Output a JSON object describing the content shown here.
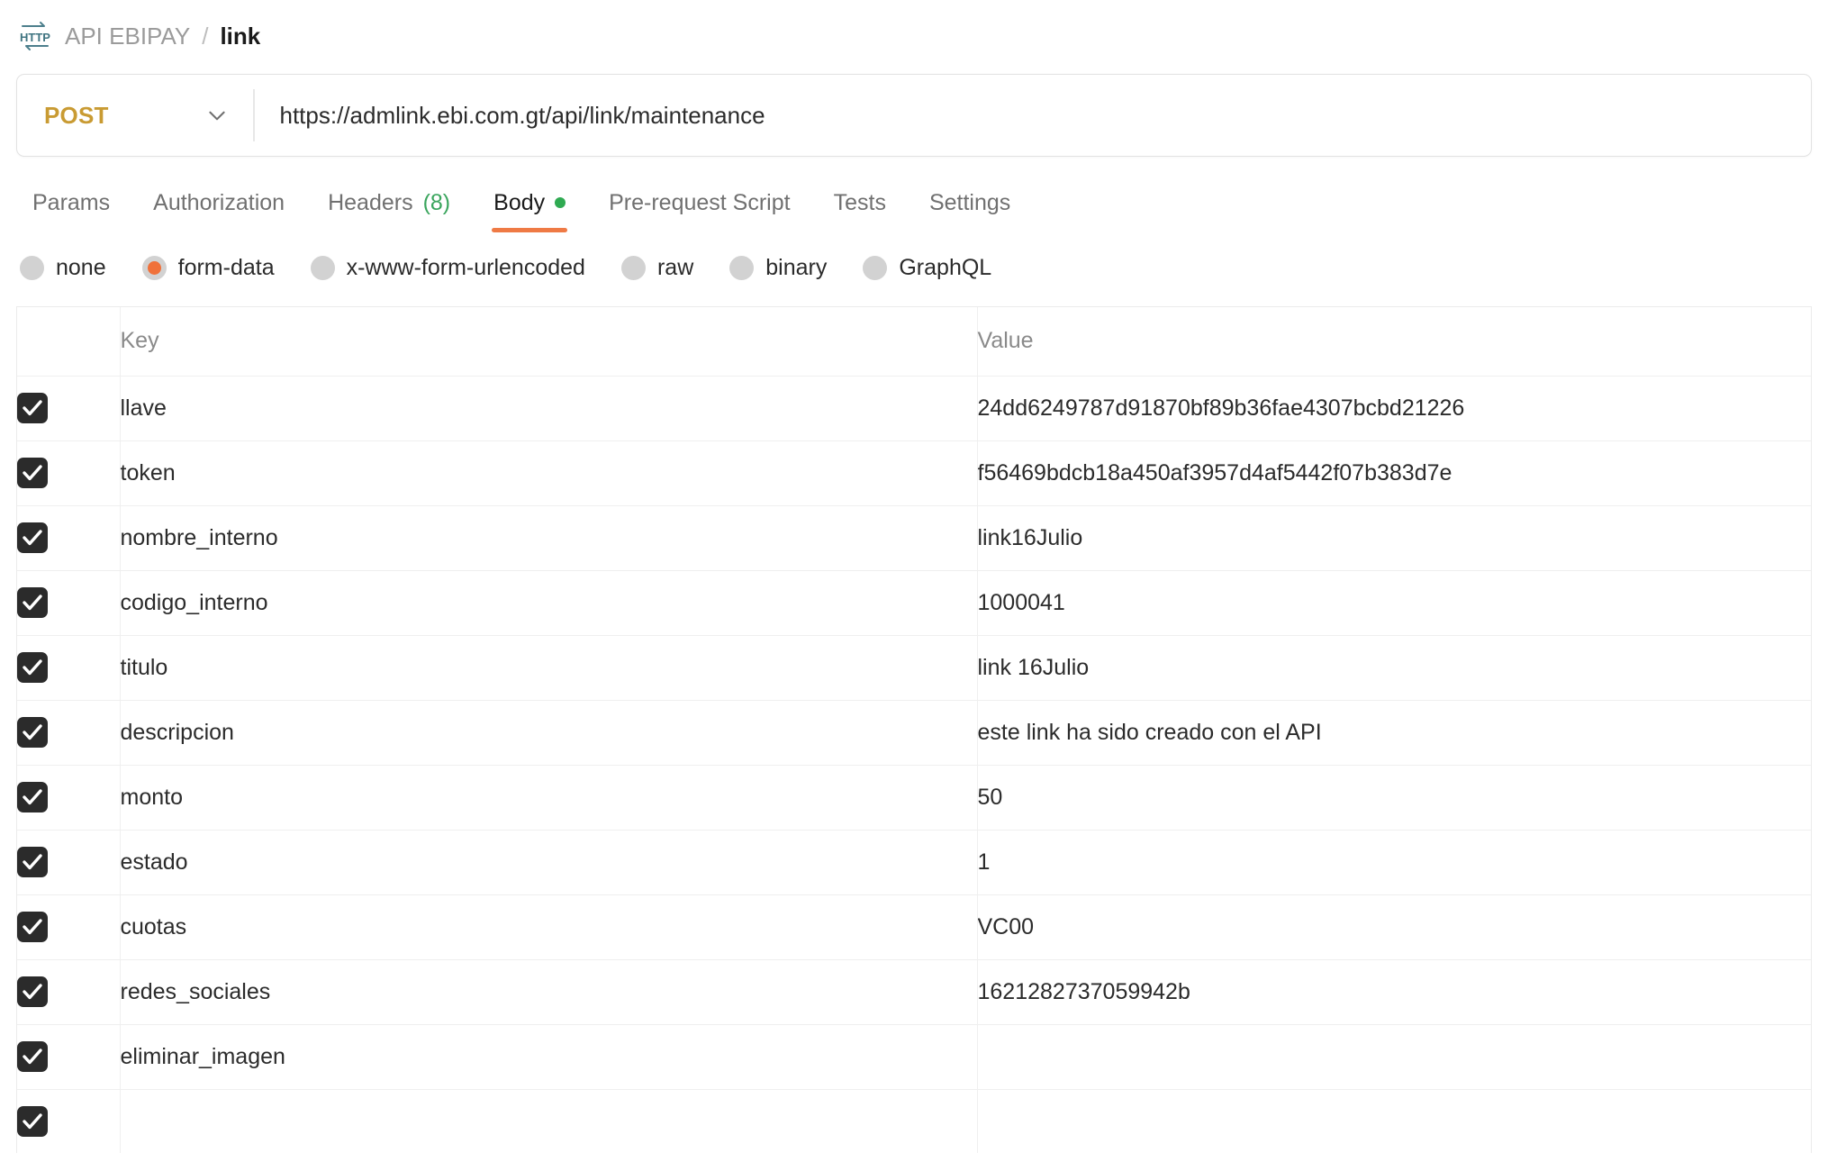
{
  "breadcrumb": {
    "icon": "http-icon",
    "collection": "API EBIPAY",
    "separator": "/",
    "current": "link"
  },
  "request_bar": {
    "method": "POST",
    "method_chevron_icon": "chevron-down-icon",
    "url": "https://admlink.ebi.com.gt/api/link/maintenance"
  },
  "tabs": [
    {
      "label": "Params",
      "active": false
    },
    {
      "label": "Authorization",
      "active": false
    },
    {
      "label": "Headers",
      "count": "(8)",
      "active": false
    },
    {
      "label": "Body",
      "active": true,
      "dot": true
    },
    {
      "label": "Pre-request Script",
      "active": false
    },
    {
      "label": "Tests",
      "active": false
    },
    {
      "label": "Settings",
      "active": false
    }
  ],
  "body_types": [
    {
      "label": "none",
      "selected": false
    },
    {
      "label": "form-data",
      "selected": true
    },
    {
      "label": "x-www-form-urlencoded",
      "selected": false
    },
    {
      "label": "raw",
      "selected": false
    },
    {
      "label": "binary",
      "selected": false
    },
    {
      "label": "GraphQL",
      "selected": false
    }
  ],
  "table": {
    "columns": {
      "key": "Key",
      "value": "Value"
    },
    "rows": [
      {
        "checked": true,
        "key": "llave",
        "value": "24dd6249787d91870bf89b36fae4307bcbd21226"
      },
      {
        "checked": true,
        "key": "token",
        "value": "f56469bdcb18a450af3957d4af5442f07b383d7e"
      },
      {
        "checked": true,
        "key": "nombre_interno",
        "value": "link16Julio"
      },
      {
        "checked": true,
        "key": "codigo_interno",
        "value": "1000041"
      },
      {
        "checked": true,
        "key": "titulo",
        "value": "link 16Julio"
      },
      {
        "checked": true,
        "key": "descripcion",
        "value": "este link ha sido creado con el API"
      },
      {
        "checked": true,
        "key": "monto",
        "value": "50"
      },
      {
        "checked": true,
        "key": "estado",
        "value": "1"
      },
      {
        "checked": true,
        "key": "cuotas",
        "value": "VC00"
      },
      {
        "checked": true,
        "key": "redes_sociales",
        "value": "1621282737059942b"
      },
      {
        "checked": true,
        "key": "eliminar_imagen",
        "value": ""
      },
      {
        "checked": true,
        "key": "",
        "value": ""
      }
    ]
  },
  "colors": {
    "method_post": "#c99b33",
    "active_tab_underline": "#ef7a45",
    "header_count": "#3aa55d",
    "body_dot": "#2faa52",
    "radio_selected": "#f0713a",
    "checkbox": "#2b2b2b",
    "http_icon": "#4d7f8c"
  }
}
